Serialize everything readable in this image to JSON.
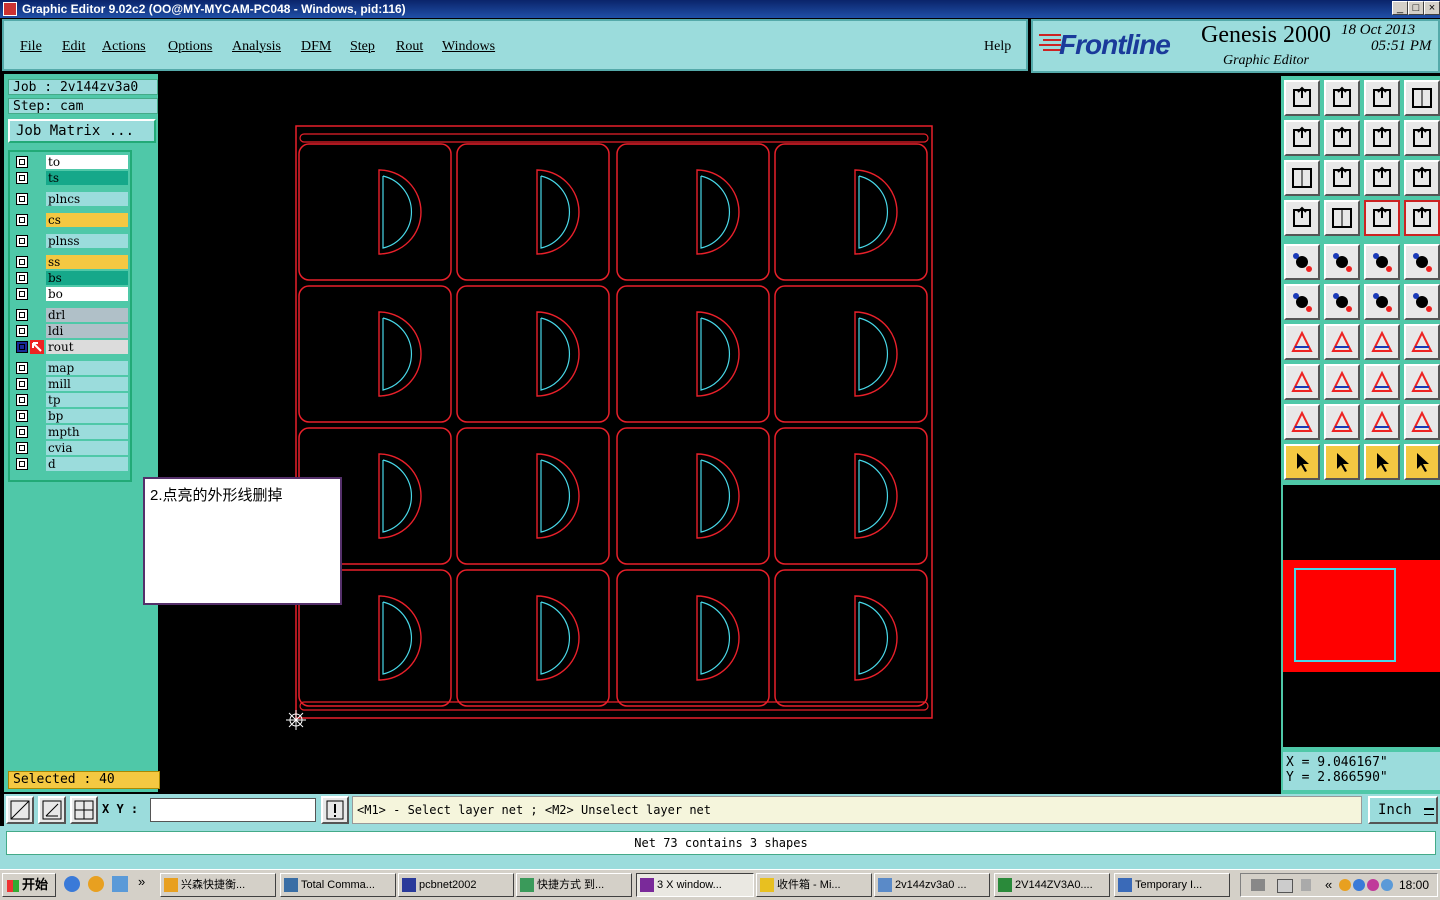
{
  "window": {
    "title": "Graphic Editor 9.02c2  (OO@MY-MYCAM-PC048 - Windows, pid:116)",
    "controls": [
      "_",
      "□",
      "×"
    ]
  },
  "menu": [
    "File",
    "Edit",
    "Actions",
    "Options",
    "Analysis",
    "DFM",
    "Step",
    "Rout",
    "Windows"
  ],
  "help_label": "Help",
  "brand": {
    "logo": "Frontline",
    "product": "Genesis 2000",
    "subtitle": "Graphic Editor",
    "date": "18 Oct 2013",
    "time": "05:51 PM"
  },
  "job": {
    "job_label": "Job : 2v144zv3a0",
    "step_label": "Step: cam",
    "matrix_button": "Job Matrix ..."
  },
  "layers": [
    {
      "name": "to",
      "color": "#ffffff"
    },
    {
      "name": "ts",
      "color": "#16a88a"
    },
    {
      "name": "plncs",
      "color": "#9bdcdc"
    },
    {
      "name": "cs",
      "color": "#f4c842"
    },
    {
      "name": "plnss",
      "color": "#9bdcdc"
    },
    {
      "name": "ss",
      "color": "#f4c842"
    },
    {
      "name": "bs",
      "color": "#16a88a"
    },
    {
      "name": "bo",
      "color": "#ffffff"
    },
    {
      "name": "drl",
      "color": "#b0c0c8"
    },
    {
      "name": "ldi",
      "color": "#b0c0c8"
    },
    {
      "name": "rout",
      "color": "#dcdcdc"
    },
    {
      "name": "map",
      "color": "#9bdcdc"
    },
    {
      "name": "mill",
      "color": "#9bdcdc"
    },
    {
      "name": "tp",
      "color": "#9bdcdc"
    },
    {
      "name": "bp",
      "color": "#9bdcdc"
    },
    {
      "name": "mpth",
      "color": "#9bdcdc"
    },
    {
      "name": "cvia",
      "color": "#9bdcdc"
    },
    {
      "name": "d",
      "color": "#9bdcdc"
    }
  ],
  "selected_label": "Selected : 40",
  "note": "2.点亮的外形线删掉",
  "coords": {
    "x": "X = 9.046167\"",
    "y": "Y = 2.866590\""
  },
  "xy_label": "X Y :",
  "prompt": "<M1> - Select layer net ; <M2> Unselect layer net",
  "unit": "Inch",
  "status": "Net 73 contains 3 shapes",
  "taskbar": {
    "start": "开始",
    "tasks": [
      "兴森快捷衡...",
      "Total Comma...",
      "pcbnet2002",
      "快捷方式 到...",
      "3 X window...",
      "收件箱 - Mi...",
      "2v144zv3a0 ...",
      "2V144ZV3A0....",
      "Temporary I..."
    ],
    "clock": "18:00"
  },
  "colors": {
    "outline": "#e8202a",
    "arc": "#48d8e8",
    "panel": "#4fc8a8",
    "menu_bg": "#9bdcdc",
    "minimap_fill": "#ff0000"
  },
  "toolbar_icons": [
    "open-icon",
    "save-icon",
    "home-icon",
    "frame-icon",
    "zoom-back-icon",
    "zoom-forward-icon",
    "undo-redo-icon",
    "route-icon",
    "zoom-fit-icon",
    "zoom-center-icon",
    "ratio-icon",
    "help-icon",
    "measure-icon",
    "grid-icon",
    "layer-color-icon",
    "layer-view-icon",
    "add-pad-icon",
    "transform-icon",
    "ruler-icon",
    "dot-icon",
    "connect-icon",
    "cross-icon",
    "move-icon",
    "copy-icon",
    "edit-line-icon",
    "line-icon",
    "arc-icon",
    "flip-icon",
    "pad-select-icon",
    "segment-icon",
    "dimension-icon",
    "shape-icon",
    "triangle-a-icon",
    "triangle-b-icon",
    "triangle-c-icon",
    "triangle-d-icon",
    "pointer-icon",
    "pointer-select-icon",
    "pointer-edit-icon",
    "net-select-icon"
  ]
}
